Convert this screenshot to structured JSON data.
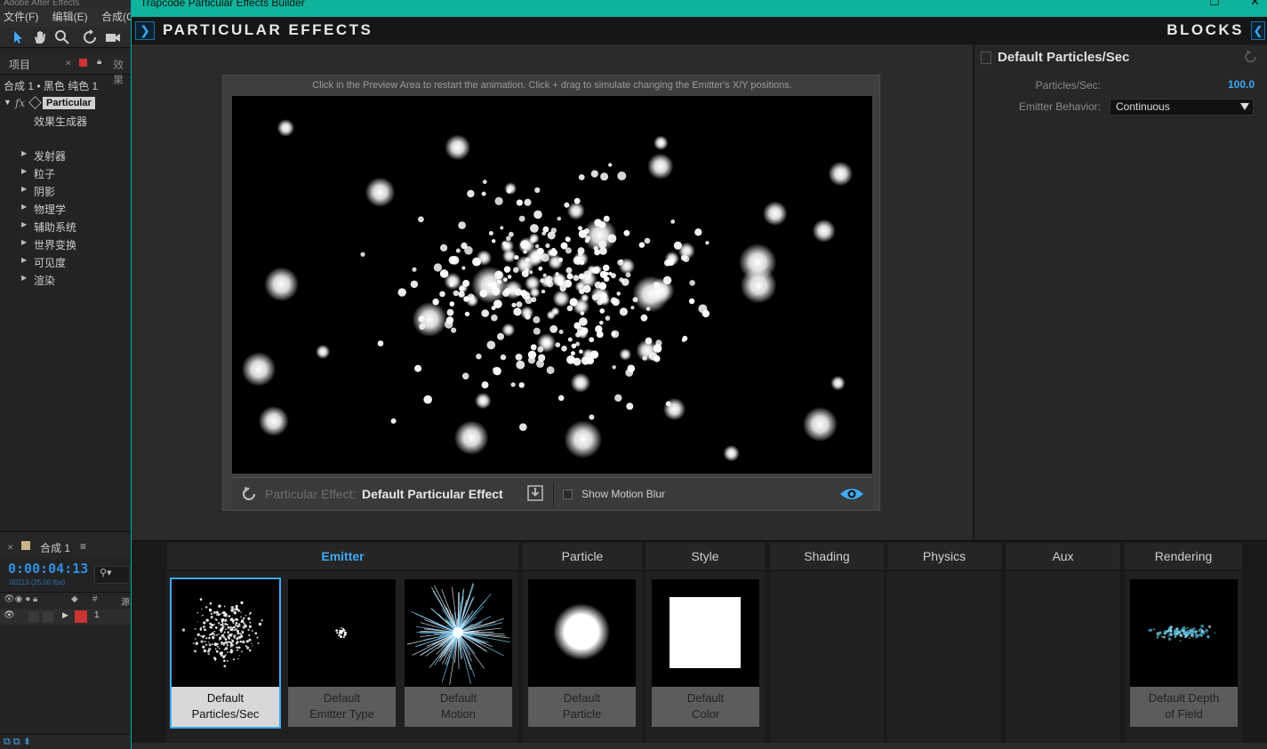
{
  "ae": {
    "title": "Adobe After Effects",
    "menu": [
      "文件(F)",
      "编辑(E)",
      "合成(C)"
    ],
    "project_tab": "项目",
    "effects_tab": "效果",
    "comp_line": "合成 1 • 黑色 纯色 1",
    "effect_name": "Particular",
    "effect_sub": "效果生成器",
    "properties": [
      "发射器",
      "粒子",
      "阴影",
      "物理学",
      "辅助系统",
      "世界变换",
      "可见度",
      "渲染"
    ],
    "timeline_comp": "合成 1",
    "timecode": "0:00:04:13",
    "fps": "00113 (25.00 fps)",
    "layer_header_num": "#",
    "layer_header_src": "源",
    "layer_number": "1"
  },
  "window": {
    "title": "Trapcode Particular Effects Builder"
  },
  "header": {
    "brand": "PARTICULAR EFFECTS",
    "blocks": "BLOCKS"
  },
  "preview": {
    "hint": "Click in the Preview Area to restart the animation. Click + drag to simulate changing the Emitter's X/Y positions.",
    "effect_label": "Particular Effect:",
    "effect_name": "Default Particular Effect",
    "motion_blur_label": "Show Motion Blur"
  },
  "inspector": {
    "title": "Default Particles/Sec",
    "rows": [
      {
        "label": "Particles/Sec:",
        "value": "100.0"
      },
      {
        "label": "Emitter Behavior:",
        "value": "Continuous"
      }
    ]
  },
  "categories": [
    {
      "label": "Emitter",
      "active": true
    },
    {
      "label": "Particle",
      "active": false
    },
    {
      "label": "Style",
      "active": false
    },
    {
      "label": "Shading",
      "active": false
    },
    {
      "label": "Physics",
      "active": false
    },
    {
      "label": "Aux",
      "active": false
    },
    {
      "label": "Rendering",
      "active": false
    }
  ],
  "blocks": [
    {
      "line1": "Default",
      "line2": "Particles/Sec",
      "selected": true
    },
    {
      "line1": "Default",
      "line2": "Emitter Type",
      "selected": false
    },
    {
      "line1": "Default",
      "line2": "Motion",
      "selected": false
    },
    {
      "line1": "Default",
      "line2": "Particle",
      "selected": false
    },
    {
      "line1": "Default",
      "line2": "Color",
      "selected": false
    },
    {
      "line1": "Default Depth",
      "line2": "of Field",
      "selected": false
    }
  ],
  "colors": {
    "accent": "#3fa9f5",
    "titlebar": "#0fb39b",
    "timecode": "#2f8fe0"
  }
}
